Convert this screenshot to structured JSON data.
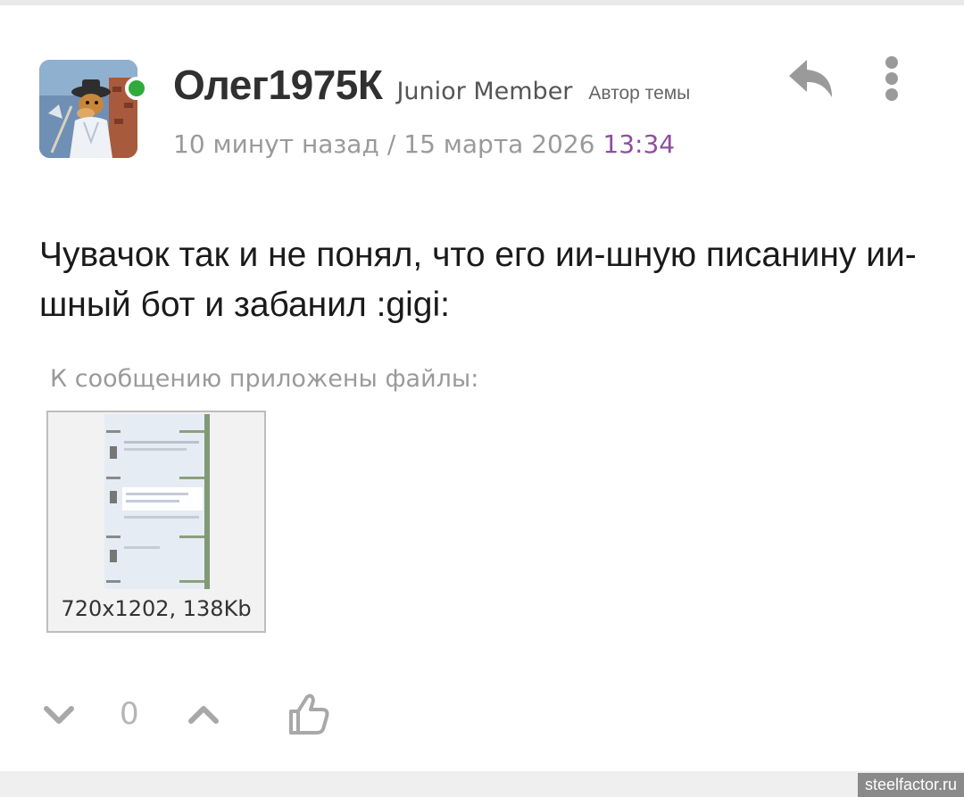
{
  "post": {
    "author": {
      "username": "Олег1975К",
      "rank": "Junior Member",
      "badge": "Автор темы",
      "online": true,
      "online_color": "#2faa3b"
    },
    "meta": {
      "relative_time": "10 минут назад",
      "separator": "/",
      "date": "15 марта 2026",
      "time": "13:34",
      "time_color": "#8e4f9e"
    },
    "body": "Чувачок так и не понял, что его ии-шную писанину ии- шный бот и забанил :gigi:",
    "attachments": {
      "label": "К сообщению приложены файлы:",
      "files": [
        {
          "info": "720x1202, 138Kb"
        }
      ]
    },
    "actions": {
      "reply_icon": "reply-icon",
      "more_icon": "more-vertical-icon"
    },
    "votes": {
      "count": "0",
      "down_icon": "chevron-down-icon",
      "up_icon": "chevron-up-icon",
      "like_icon": "thumbs-up-icon"
    }
  },
  "watermark": "steelfactor.ru"
}
